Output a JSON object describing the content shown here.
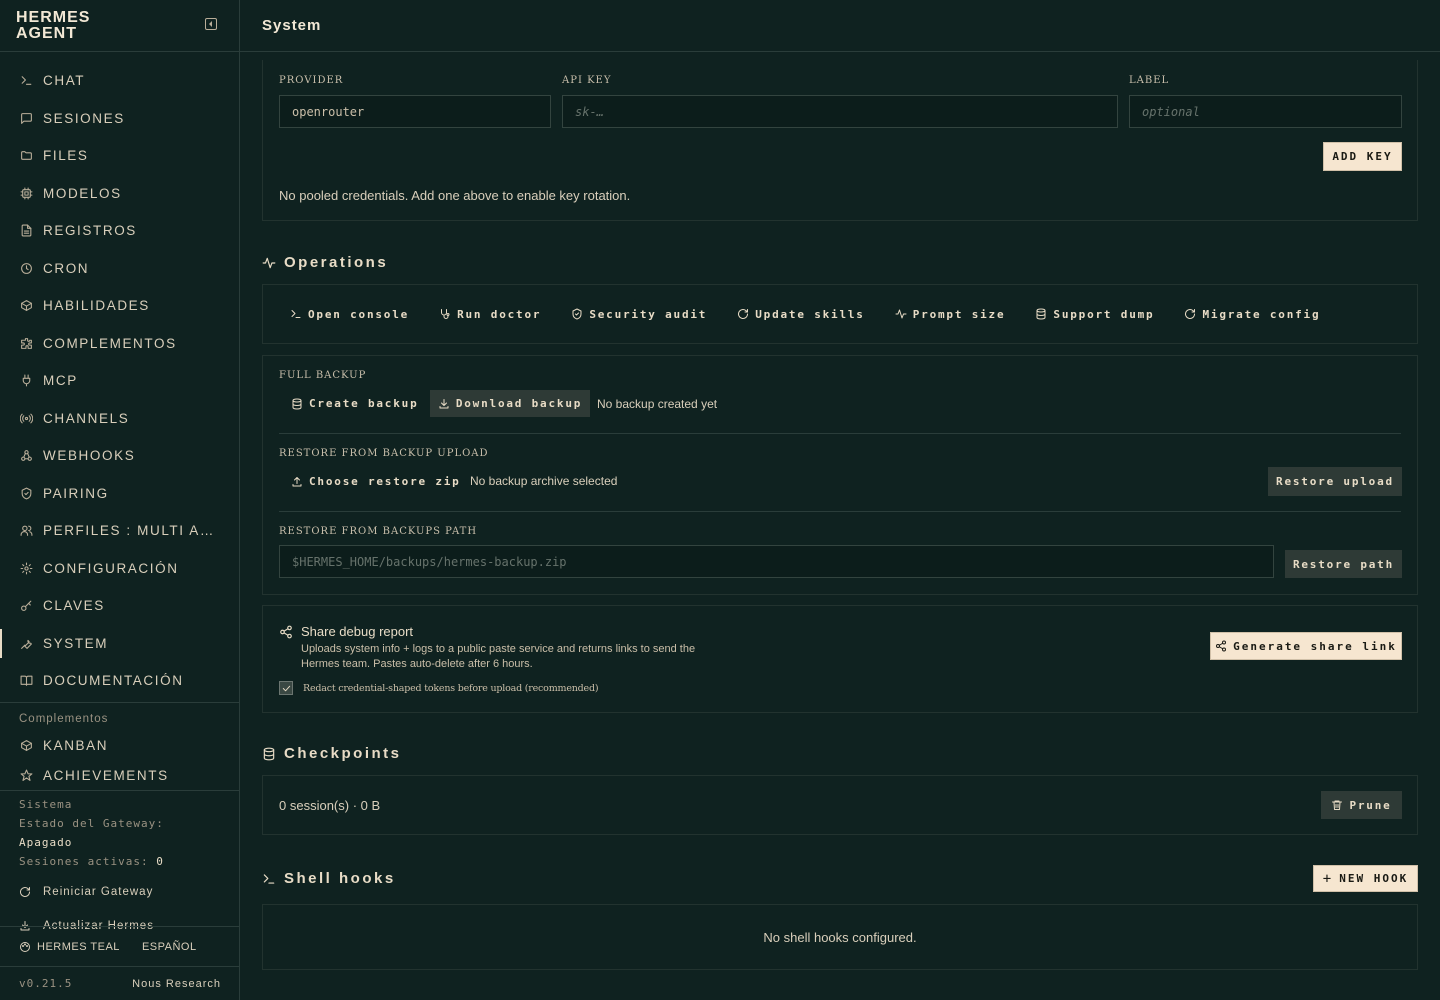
{
  "brand": {
    "title": "HERMES AGENT"
  },
  "nav": [
    {
      "label": "CHAT",
      "icon": "terminal-icon"
    },
    {
      "label": "SESIONES",
      "icon": "message-icon"
    },
    {
      "label": "FILES",
      "icon": "folder-icon"
    },
    {
      "label": "MODELOS",
      "icon": "cpu-icon"
    },
    {
      "label": "REGISTROS",
      "icon": "file-text-icon"
    },
    {
      "label": "CRON",
      "icon": "clock-icon"
    },
    {
      "label": "HABILIDADES",
      "icon": "package-icon"
    },
    {
      "label": "COMPLEMENTOS",
      "icon": "puzzle-icon"
    },
    {
      "label": "MCP",
      "icon": "plug-icon"
    },
    {
      "label": "CHANNELS",
      "icon": "radio-icon"
    },
    {
      "label": "WEBHOOKS",
      "icon": "webhook-icon"
    },
    {
      "label": "PAIRING",
      "icon": "shield-icon"
    },
    {
      "label": "PERFILES : MULTI AGENTE",
      "icon": "users-icon"
    },
    {
      "label": "CONFIGURACIÓN",
      "icon": "gear-icon"
    },
    {
      "label": "CLAVES",
      "icon": "key-icon"
    },
    {
      "label": "SYSTEM",
      "icon": "wrench-icon"
    },
    {
      "label": "DOCUMENTACIÓN",
      "icon": "book-icon"
    }
  ],
  "plugins_section": {
    "label": "Complementos",
    "items": [
      {
        "label": "KANBAN",
        "icon": "package-icon"
      },
      {
        "label": "ACHIEVEMENTS",
        "icon": "star-icon"
      }
    ]
  },
  "system_status": {
    "heading": "Sistema",
    "gateway_label": "Estado del Gateway:",
    "gateway_value": "Apagado",
    "sessions_label": "Sesiones activas:",
    "sessions_value": "0",
    "restart_label": "Reiniciar Gateway",
    "update_label": "Actualizar Hermes"
  },
  "footer": {
    "theme": "HERMES TEAL",
    "language": "ESPAÑOL",
    "version": "v0.21.5",
    "org": "Nous Research"
  },
  "page": {
    "title": "System"
  },
  "credentials": {
    "provider_label": "PROVIDER",
    "provider_value": "openrouter",
    "apikey_label": "API KEY",
    "apikey_placeholder": "sk-…",
    "label_label": "LABEL",
    "label_placeholder": "optional",
    "add_key": "ADD KEY",
    "empty_note": "No pooled credentials. Add one above to enable key rotation."
  },
  "operations": {
    "heading": "Operations",
    "buttons": [
      {
        "label": "Open console"
      },
      {
        "label": "Run doctor"
      },
      {
        "label": "Security audit"
      },
      {
        "label": "Update skills"
      },
      {
        "label": "Prompt size"
      },
      {
        "label": "Support dump"
      },
      {
        "label": "Migrate config"
      }
    ]
  },
  "backup": {
    "full_label": "FULL BACKUP",
    "create": "Create backup",
    "download": "Download backup",
    "none_note": "No backup created yet",
    "restore_upload_label": "RESTORE FROM BACKUP UPLOAD",
    "choose_zip": "Choose restore zip",
    "no_archive": "No backup archive selected",
    "restore_upload_btn": "Restore upload",
    "restore_path_label": "RESTORE FROM BACKUPS PATH",
    "path_placeholder": "$HERMES_HOME/backups/hermes-backup.zip",
    "restore_path_btn": "Restore path"
  },
  "debug": {
    "title": "Share debug report",
    "desc_line1": "Uploads system info + logs to a public paste service and returns links to send the",
    "desc_line2": "Hermes team. Pastes auto-delete after 6 hours.",
    "redact_label": "Redact credential-shaped tokens before upload (recommended)",
    "redact_checked": true,
    "generate": "Generate share link"
  },
  "checkpoints": {
    "heading": "Checkpoints",
    "summary": "0 session(s) · 0 B",
    "prune": "Prune"
  },
  "shell_hooks": {
    "heading": "Shell hooks",
    "new_hook": "NEW HOOK",
    "empty": "No shell hooks configured."
  },
  "colors": {
    "background": "#0f2220",
    "text": "#e8dcc6",
    "accent_button": "#f6e6d0",
    "dark_button": "#2e3a36",
    "border": "#22332f"
  }
}
